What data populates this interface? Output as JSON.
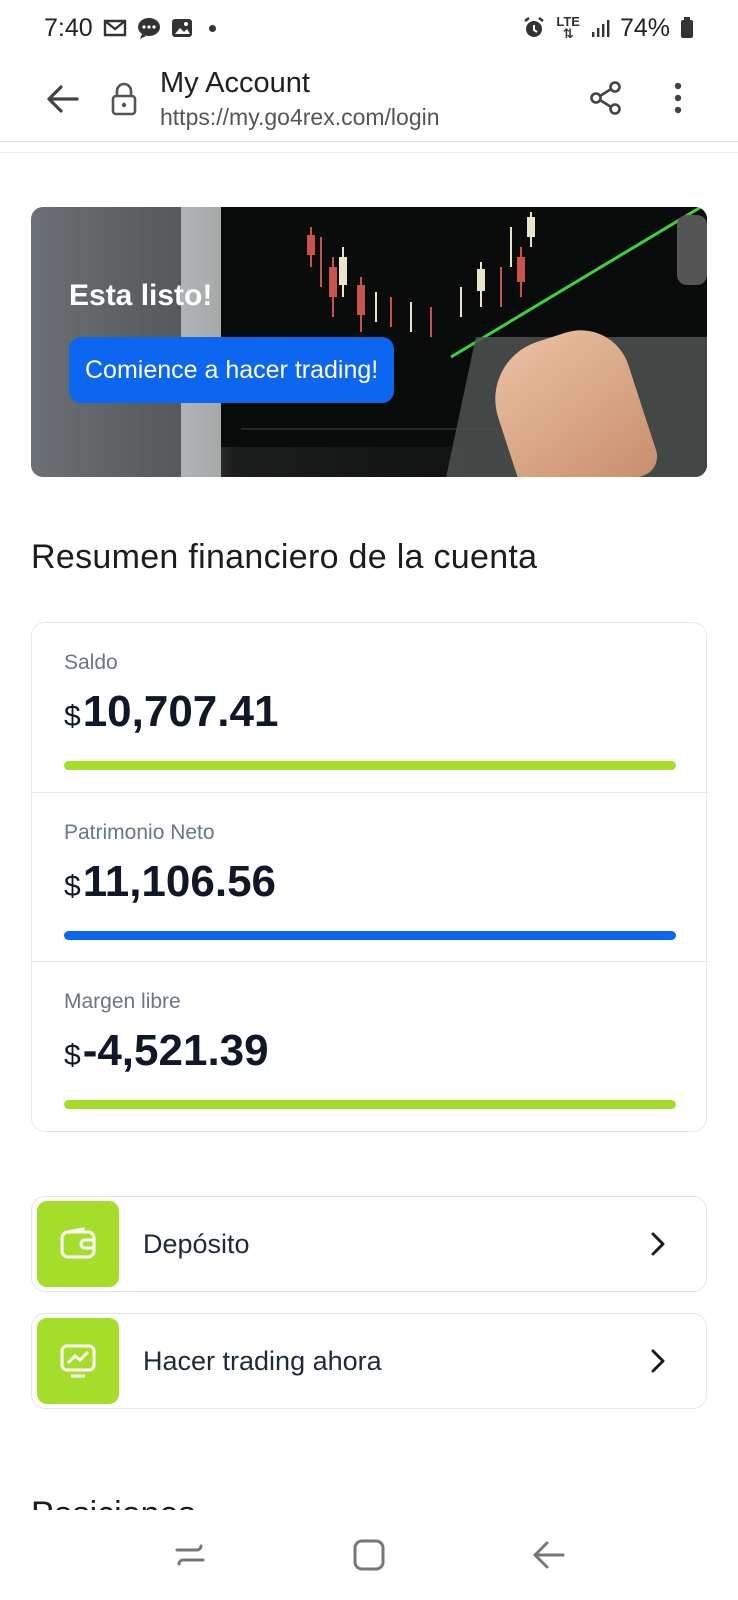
{
  "status_bar": {
    "time": "7:40",
    "network": "LTE",
    "battery": "74%"
  },
  "browser": {
    "title": "My Account",
    "url": "https://my.go4rex.com/login"
  },
  "hero": {
    "heading": "Esta listo!",
    "cta_label": "Comience a hacer trading!"
  },
  "summary": {
    "title": "Resumen financiero de la cuenta",
    "metrics": [
      {
        "label": "Saldo",
        "currency": "$",
        "value": "10,707.41",
        "bar_color": "#a4de2a"
      },
      {
        "label": "Patrimonio Neto",
        "currency": "$",
        "value": "11,106.56",
        "bar_color": "#0d66f0"
      },
      {
        "label": "Margen libre",
        "currency": "$",
        "value": "-4,521.39",
        "bar_color": "#a4de2a"
      }
    ]
  },
  "actions": [
    {
      "label": "Depósito",
      "icon": "wallet-icon"
    },
    {
      "label": "Hacer trading ahora",
      "icon": "trading-chart-icon"
    }
  ],
  "next_section_title": "Posiciones",
  "colors": {
    "accent_blue": "#0d66f0",
    "accent_green": "#a4de2a"
  }
}
